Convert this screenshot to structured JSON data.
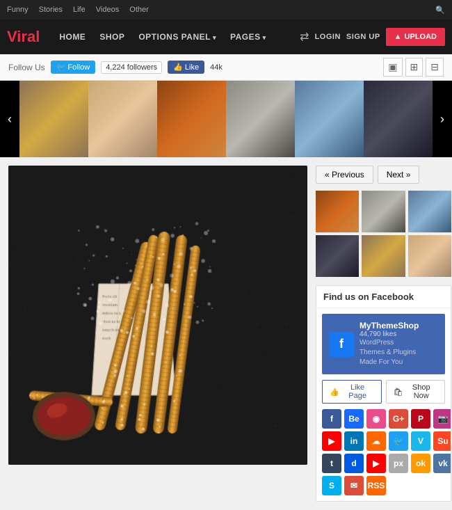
{
  "topnav": {
    "items": [
      "Funny",
      "Stories",
      "Life",
      "Videos",
      "Other"
    ]
  },
  "logo": {
    "prefix": "V",
    "suffix": "iral"
  },
  "mainnav": {
    "items": [
      {
        "label": "HOME",
        "hasArrow": false
      },
      {
        "label": "SHOP",
        "hasArrow": false
      },
      {
        "label": "OPTIONS PANEL",
        "hasArrow": true
      },
      {
        "label": "PAGES",
        "hasArrow": true
      }
    ],
    "login": "LOGIN",
    "signup": "SIGN UP",
    "upload": "UPLOAD"
  },
  "followbar": {
    "label": "Follow Us",
    "twitter_btn": "Follow",
    "twitter_count": "4,224 followers",
    "fb_btn": "Like",
    "fb_count": "44k"
  },
  "sidebar": {
    "prev": "« Previous",
    "next": "Next »",
    "fb_header": "Find us on Facebook",
    "fb_page_name": "MyThemeShop",
    "fb_page_likes": "44,790 likes",
    "fb_page_desc": "WordPress\nThemes & Plugins\nMade For You",
    "fb_like_btn": "Like Page",
    "fb_shop_btn": "Shop Now"
  }
}
